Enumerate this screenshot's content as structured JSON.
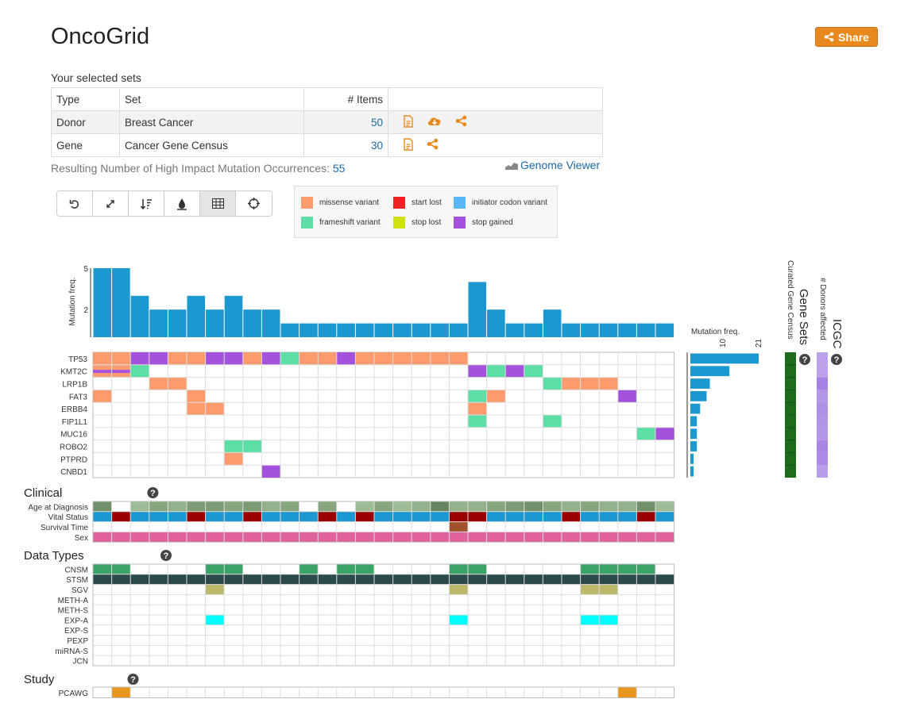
{
  "title": "OncoGrid",
  "share_label": "Share",
  "sets": {
    "heading": "Your selected sets",
    "columns": [
      "Type",
      "Set",
      "# Items"
    ],
    "rows": [
      {
        "type": "Donor",
        "set": "Breast Cancer",
        "items": "50"
      },
      {
        "type": "Gene",
        "set": "Cancer Gene Census",
        "items": "30"
      }
    ]
  },
  "result": {
    "label": "Resulting Number of High Impact Mutation Occurrences:",
    "value": "55"
  },
  "genome_viewer_label": "Genome Viewer",
  "toolbar": {
    "buttons": [
      "undo-icon",
      "fullscreen-icon",
      "sort-icon",
      "heatmap-icon",
      "grid-icon",
      "crosshair-icon"
    ],
    "active": "grid-icon"
  },
  "legend": [
    {
      "label": "missense variant",
      "color": "#fc9b6e"
    },
    {
      "label": "start lost",
      "color": "#ee2222"
    },
    {
      "label": "initiator codon variant",
      "color": "#5ab7f5"
    },
    {
      "label": "frameshift variant",
      "color": "#5ddea5"
    },
    {
      "label": "stop lost",
      "color": "#cfe10e"
    },
    {
      "label": "stop gained",
      "color": "#a452dd"
    }
  ],
  "grid": {
    "genes": [
      "TP53",
      "KMT2C",
      "LRP1B",
      "FAT3",
      "ERBB4",
      "FIP1L1",
      "MUC16",
      "ROBO2",
      "PTPRD",
      "CNBD1"
    ],
    "mutation_freq_label": "Mutation freq.",
    "donor_hist_ticks": [
      "5",
      "2"
    ],
    "donor_counts": [
      5,
      5,
      3,
      2,
      2,
      3,
      2,
      3,
      2,
      2,
      1,
      1,
      1,
      1,
      1,
      1,
      1,
      1,
      1,
      1,
      4,
      2,
      1,
      1,
      2,
      1,
      1,
      1,
      1,
      1,
      1
    ],
    "gene_counts": [
      21,
      12,
      6,
      5,
      3,
      2,
      2,
      2,
      1,
      1
    ],
    "gene_hist_ticks": [
      "10",
      "21"
    ],
    "cells": [
      {
        "g": 0,
        "d": 0,
        "t": "m"
      },
      {
        "g": 0,
        "d": 1,
        "t": "m"
      },
      {
        "g": 0,
        "d": 2,
        "t": "s"
      },
      {
        "g": 0,
        "d": 3,
        "t": "s"
      },
      {
        "g": 0,
        "d": 4,
        "t": "m"
      },
      {
        "g": 0,
        "d": 5,
        "t": "m"
      },
      {
        "g": 0,
        "d": 6,
        "t": "s"
      },
      {
        "g": 0,
        "d": 7,
        "t": "s"
      },
      {
        "g": 0,
        "d": 8,
        "t": "m"
      },
      {
        "g": 0,
        "d": 9,
        "t": "s"
      },
      {
        "g": 0,
        "d": 10,
        "t": "f"
      },
      {
        "g": 0,
        "d": 11,
        "t": "m"
      },
      {
        "g": 0,
        "d": 12,
        "t": "m"
      },
      {
        "g": 0,
        "d": 13,
        "t": "s"
      },
      {
        "g": 0,
        "d": 14,
        "t": "m"
      },
      {
        "g": 0,
        "d": 15,
        "t": "m"
      },
      {
        "g": 0,
        "d": 16,
        "t": "m"
      },
      {
        "g": 0,
        "d": 17,
        "t": "m"
      },
      {
        "g": 0,
        "d": 18,
        "t": "m"
      },
      {
        "g": 0,
        "d": 19,
        "t": "m"
      },
      {
        "g": 1,
        "d": 0,
        "t": "s",
        "split": "m"
      },
      {
        "g": 1,
        "d": 1,
        "t": "s",
        "split": "m"
      },
      {
        "g": 1,
        "d": 2,
        "t": "f"
      },
      {
        "g": 1,
        "d": 20,
        "t": "s"
      },
      {
        "g": 1,
        "d": 21,
        "t": "f"
      },
      {
        "g": 1,
        "d": 22,
        "t": "s"
      },
      {
        "g": 1,
        "d": 23,
        "t": "f"
      },
      {
        "g": 2,
        "d": 3,
        "t": "m"
      },
      {
        "g": 2,
        "d": 4,
        "t": "m"
      },
      {
        "g": 2,
        "d": 24,
        "t": "f"
      },
      {
        "g": 2,
        "d": 25,
        "t": "m"
      },
      {
        "g": 2,
        "d": 26,
        "t": "m"
      },
      {
        "g": 2,
        "d": 27,
        "t": "m"
      },
      {
        "g": 3,
        "d": 0,
        "t": "m"
      },
      {
        "g": 3,
        "d": 5,
        "t": "m"
      },
      {
        "g": 3,
        "d": 20,
        "t": "f"
      },
      {
        "g": 3,
        "d": 21,
        "t": "m"
      },
      {
        "g": 3,
        "d": 28,
        "t": "s"
      },
      {
        "g": 4,
        "d": 5,
        "t": "m"
      },
      {
        "g": 4,
        "d": 6,
        "t": "m"
      },
      {
        "g": 4,
        "d": 20,
        "t": "m"
      },
      {
        "g": 5,
        "d": 20,
        "t": "f"
      },
      {
        "g": 5,
        "d": 24,
        "t": "f"
      },
      {
        "g": 6,
        "d": 29,
        "t": "f"
      },
      {
        "g": 6,
        "d": 30,
        "t": "s"
      },
      {
        "g": 7,
        "d": 7,
        "t": "f"
      },
      {
        "g": 7,
        "d": 8,
        "t": "f"
      },
      {
        "g": 8,
        "d": 7,
        "t": "m"
      },
      {
        "g": 9,
        "d": 9,
        "t": "s"
      }
    ]
  },
  "gene_sets": {
    "title": "Gene Sets",
    "track_label": "Curated Gene Census",
    "color": "#1c6c1c"
  },
  "icgc": {
    "title": "ICGC",
    "track_label": "# Donors affected",
    "levels": [
      0.5,
      0.5,
      0.85,
      0.6,
      0.7,
      0.65,
      0.6,
      0.8,
      0.75,
      0.55
    ]
  },
  "clinical": {
    "title": "Clinical",
    "tracks": [
      "Age at Diagnosis",
      "Vital Status",
      "Survival Time",
      "Sex"
    ],
    "age_levels": [
      0.6,
      0,
      0.2,
      0.4,
      0.3,
      0.5,
      0.5,
      0.4,
      0.5,
      0.3,
      0.4,
      0,
      0.4,
      0,
      0.2,
      0.4,
      0.2,
      0.3,
      0.7,
      0.3,
      0.3,
      0.4,
      0.5,
      0.6,
      0.4,
      0.3,
      0.4,
      0.3,
      0.3,
      0.6,
      0.2
    ],
    "vital_deceased": [
      1,
      5,
      8,
      12,
      14,
      19,
      20,
      25,
      29
    ],
    "survival_marked": [
      19
    ],
    "vital_alive_color": "#1b98cf",
    "vital_deceased_color": "#990000",
    "sex_color": "#e0629c"
  },
  "data_types": {
    "title": "Data Types",
    "tracks": [
      "CNSM",
      "STSM",
      "SGV",
      "METH-A",
      "METH-S",
      "EXP-A",
      "EXP-S",
      "PEXP",
      "miRNA-S",
      "JCN"
    ],
    "colors": [
      "#3aa366",
      "#2b4a4a",
      "#bdb76b",
      "#dddddd",
      "#dddddd",
      "#00ffff",
      "#dddddd",
      "#dddddd",
      "#dddddd",
      "#dddddd"
    ],
    "filled": [
      [
        0,
        1,
        6,
        7,
        11,
        13,
        14,
        19,
        20,
        26,
        27,
        28,
        29
      ],
      [
        0,
        1,
        2,
        3,
        4,
        5,
        6,
        7,
        8,
        9,
        10,
        11,
        12,
        13,
        14,
        15,
        16,
        17,
        18,
        19,
        20,
        21,
        22,
        23,
        24,
        25,
        26,
        27,
        28,
        29,
        30
      ],
      [
        6,
        19,
        26,
        27
      ],
      [],
      [],
      [
        6,
        19,
        26,
        27
      ],
      [],
      [],
      [],
      []
    ]
  },
  "study": {
    "title": "Study",
    "tracks": [
      "PCAWG"
    ],
    "filled": [
      1,
      28
    ],
    "color": "#e8961e"
  }
}
